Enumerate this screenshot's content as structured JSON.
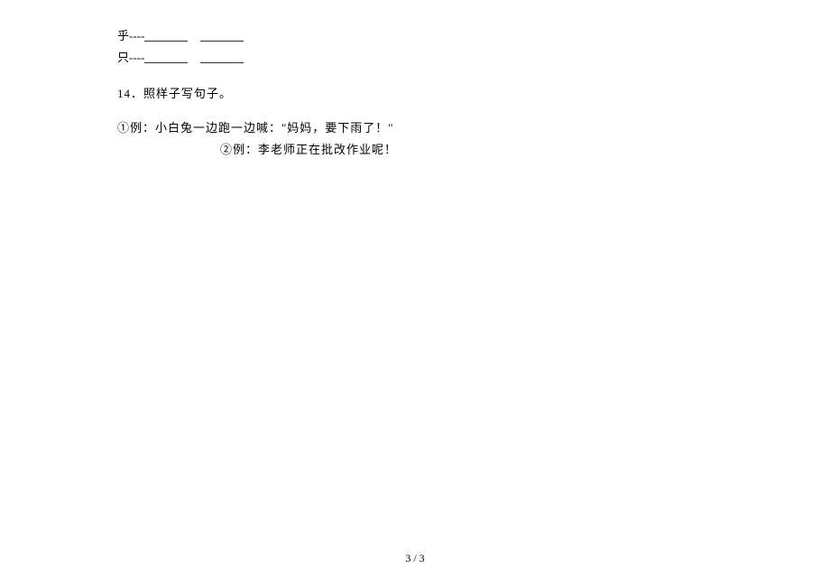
{
  "lines": {
    "row1_char": "乎----",
    "row2_char": "只----"
  },
  "q14": {
    "number": "14．",
    "prompt": "照样子写句子。"
  },
  "examples": {
    "ex1": "①例：小白兔一边跑一边喊：\"妈妈，要下雨了！\"",
    "ex2": "②例：李老师正在批改作业呢！"
  },
  "footer": "3 / 3"
}
